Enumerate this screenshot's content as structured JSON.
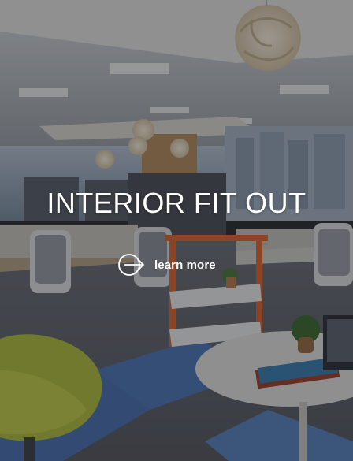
{
  "hero": {
    "title": "INTERIOR FIT OUT",
    "cta_label": "learn more",
    "cta_icon": "circle-arrow-right-icon",
    "background_image": "office-interior-photo",
    "overlay_color": "#14161a"
  }
}
